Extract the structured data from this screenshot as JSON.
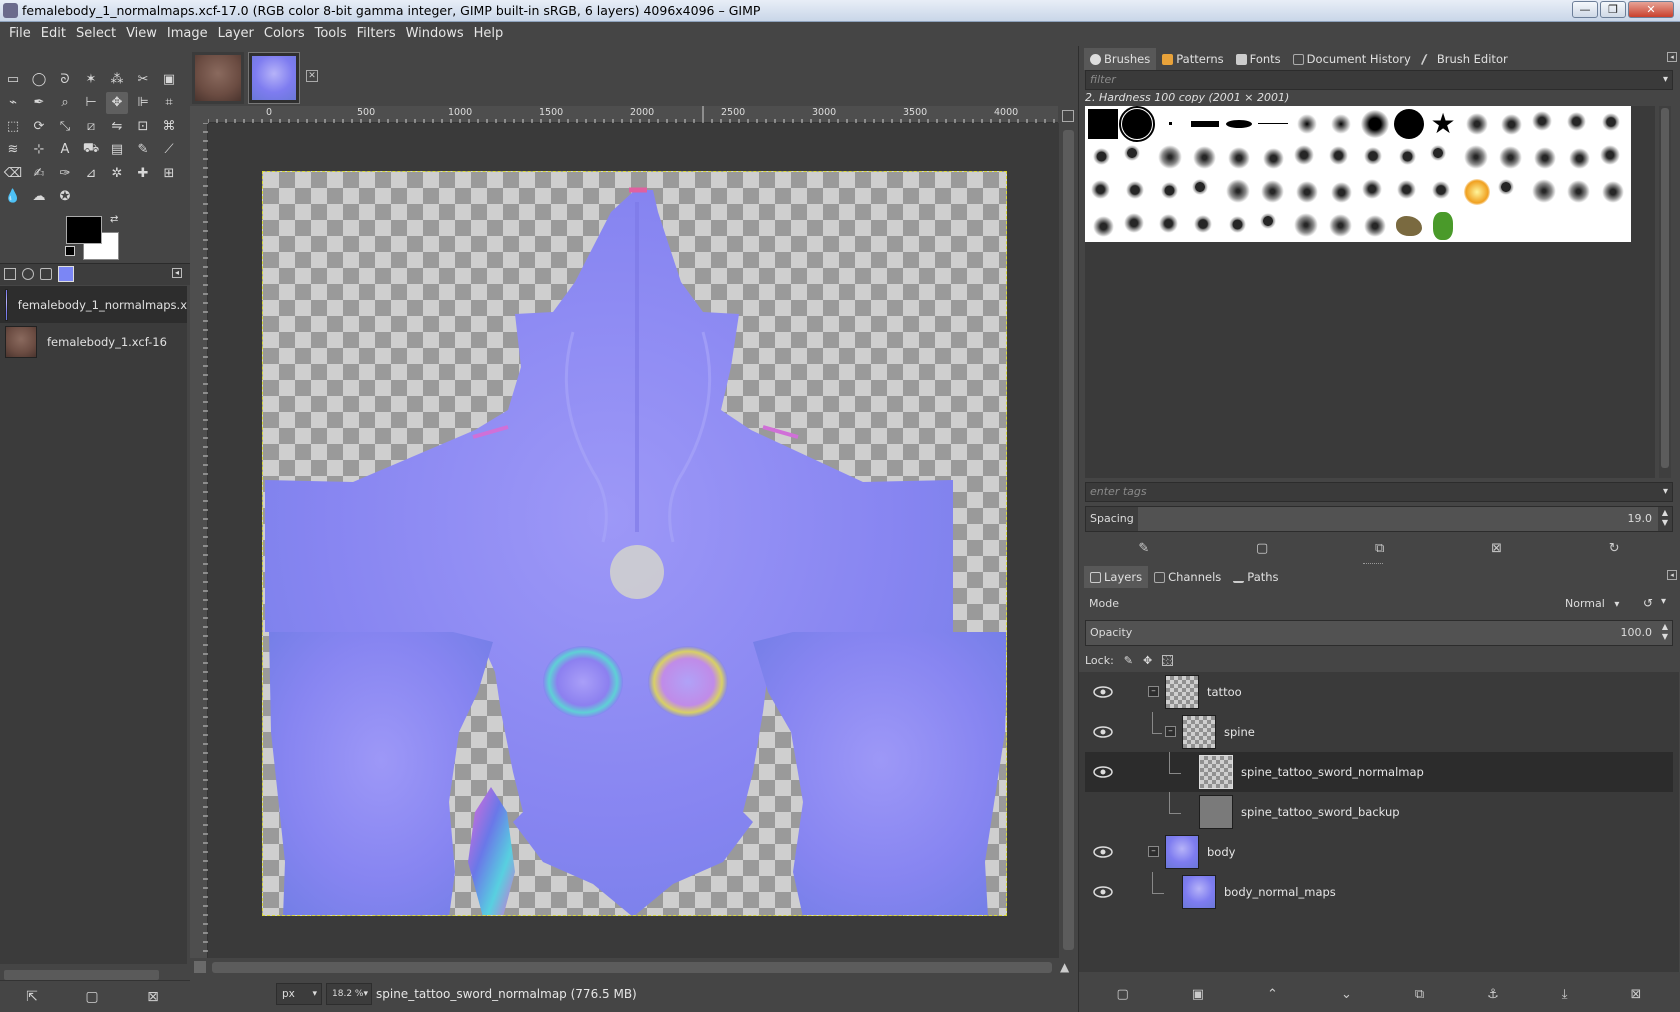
{
  "window": {
    "title": "femalebody_1_normalmaps.xcf-17.0 (RGB color 8-bit gamma integer, GIMP built-in sRGB, 6 layers) 4096x4096 – GIMP",
    "minimize": "—",
    "maximize": "❐",
    "close": "✕"
  },
  "menu": [
    "File",
    "Edit",
    "Select",
    "View",
    "Image",
    "Layer",
    "Colors",
    "Tools",
    "Filters",
    "Windows",
    "Help"
  ],
  "images_panel": {
    "items": [
      {
        "name": "femalebody_1_normalmaps.x",
        "selected": true
      },
      {
        "name": "femalebody_1.xcf-16",
        "selected": false
      }
    ]
  },
  "ruler": {
    "top_labels": [
      "0",
      "500",
      "1000",
      "1500",
      "2000",
      "2500",
      "3000",
      "3500",
      "4000"
    ]
  },
  "statusbar": {
    "unit": "px",
    "zoom": "18.2 %",
    "message": "spine_tattoo_sword_normalmap (776.5 MB)"
  },
  "brushes_panel": {
    "tabs": [
      "Brushes",
      "Patterns",
      "Fonts",
      "Document History",
      "Brush Editor"
    ],
    "filter_placeholder": "filter",
    "brush_title": "2. Hardness 100 copy (2001 × 2001)",
    "tags_placeholder": "enter tags",
    "spacing_label": "Spacing",
    "spacing_value": "19.0"
  },
  "layers_panel": {
    "tabs": [
      "Layers",
      "Channels",
      "Paths"
    ],
    "mode_label": "Mode",
    "mode_value": "Normal",
    "opacity_label": "Opacity",
    "opacity_value": "100.0",
    "lock_label": "Lock:",
    "layers": [
      {
        "name": "tattoo",
        "visible": true,
        "depth": 0,
        "group": true
      },
      {
        "name": "spine",
        "visible": true,
        "depth": 1,
        "group": true
      },
      {
        "name": "spine_tattoo_sword_normalmap",
        "visible": true,
        "depth": 2,
        "group": false,
        "selected": true
      },
      {
        "name": "spine_tattoo_sword_backup",
        "visible": false,
        "depth": 2,
        "group": false
      },
      {
        "name": "body",
        "visible": true,
        "depth": 0,
        "group": true
      },
      {
        "name": "body_normal_maps",
        "visible": true,
        "depth": 1,
        "group": false
      }
    ]
  },
  "colors": {
    "accent": "#7b86f5",
    "normal_map": "#8a87f0",
    "selection_border": "#d8d838"
  }
}
